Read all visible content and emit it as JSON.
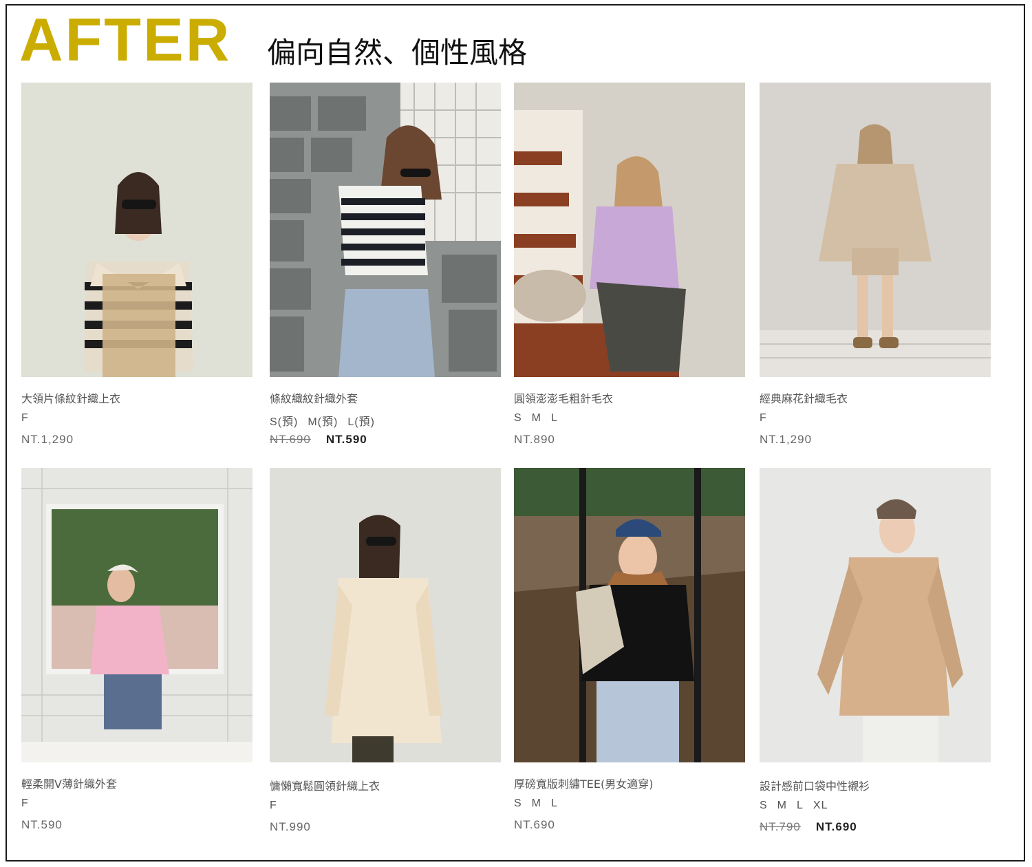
{
  "header": {
    "title": "AFTER",
    "title_color": "#cbac00",
    "subtitle": "偏向自然、個性風格"
  },
  "products": [
    {
      "name": "大領片條紋針織上衣",
      "sizes": [
        "F"
      ],
      "price": "NT.1,290",
      "old_price": "",
      "image": "striped-collar-knit-model"
    },
    {
      "name": "條紋織紋針織外套",
      "sizes": [
        "S(預)",
        "M(預)",
        "L(預)"
      ],
      "price": "NT.590",
      "old_price": "NT.690",
      "image": "striped-knit-vest-model"
    },
    {
      "name": "圓領澎澎毛粗針毛衣",
      "sizes": [
        "S",
        "M",
        "L"
      ],
      "price": "NT.890",
      "old_price": "",
      "image": "lavender-sweater-stairs-model"
    },
    {
      "name": "經典麻花針織毛衣",
      "sizes": [
        "F"
      ],
      "price": "NT.1,290",
      "old_price": "",
      "image": "cable-knit-sweater-model"
    },
    {
      "name": "輕柔開V薄針織外套",
      "sizes": [
        "F"
      ],
      "price": "NT.590",
      "old_price": "",
      "image": "pink-cardigan-kitchen-model"
    },
    {
      "name": "慵懶寬鬆圓領針織上衣",
      "sizes": [
        "F"
      ],
      "price": "NT.990",
      "old_price": "",
      "image": "cream-oversized-knit-model"
    },
    {
      "name": "厚磅寬版刺繡TEE(男女適穿)",
      "sizes": [
        "S",
        "M",
        "L"
      ],
      "price": "NT.690",
      "old_price": "",
      "image": "black-tee-swing-model"
    },
    {
      "name": "設計感前口袋中性襯衫",
      "sizes": [
        "S",
        "M",
        "L",
        "XL"
      ],
      "price": "NT.690",
      "old_price": "NT.790",
      "image": "beige-shirt-model"
    }
  ]
}
